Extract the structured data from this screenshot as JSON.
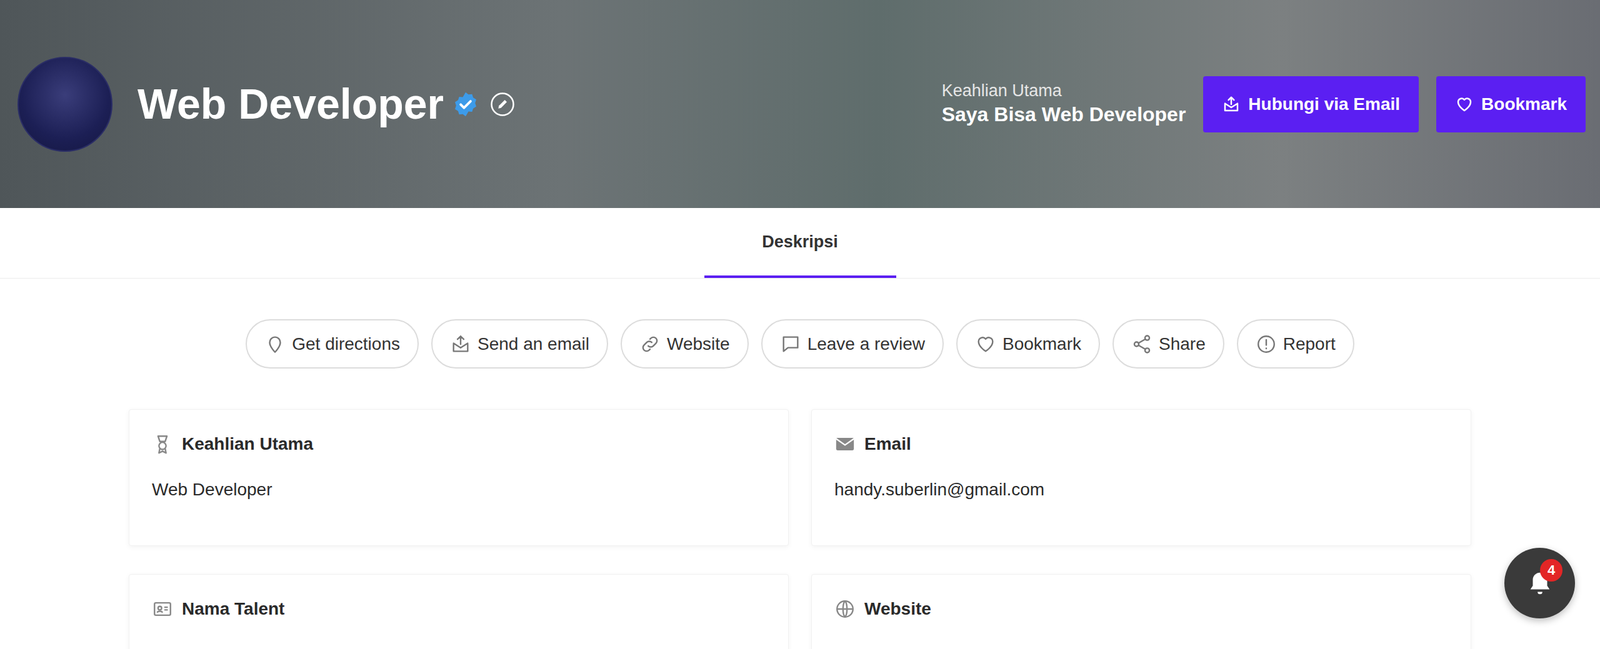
{
  "profile": {
    "title": "Web Developer",
    "verified": true
  },
  "headline": {
    "label": "Keahlian Utama",
    "value": "Saya Bisa Web Developer"
  },
  "header_buttons": [
    "Hubungi via Email",
    "Bookmark"
  ],
  "tabs": [
    {
      "label": "Deskripsi",
      "selected": true
    }
  ],
  "actions": [
    "Get directions",
    "Send an email",
    "Website",
    "Leave a review",
    "Bookmark",
    "Share",
    "Report"
  ],
  "cards": [
    {
      "title": "Keahlian Utama",
      "value": "Web Developer"
    },
    {
      "title": "Email",
      "value": "handy.suberlin@gmail.com"
    },
    {
      "title": "Nama Talent"
    },
    {
      "title": "Website"
    }
  ],
  "notifications": {
    "count": "4"
  }
}
